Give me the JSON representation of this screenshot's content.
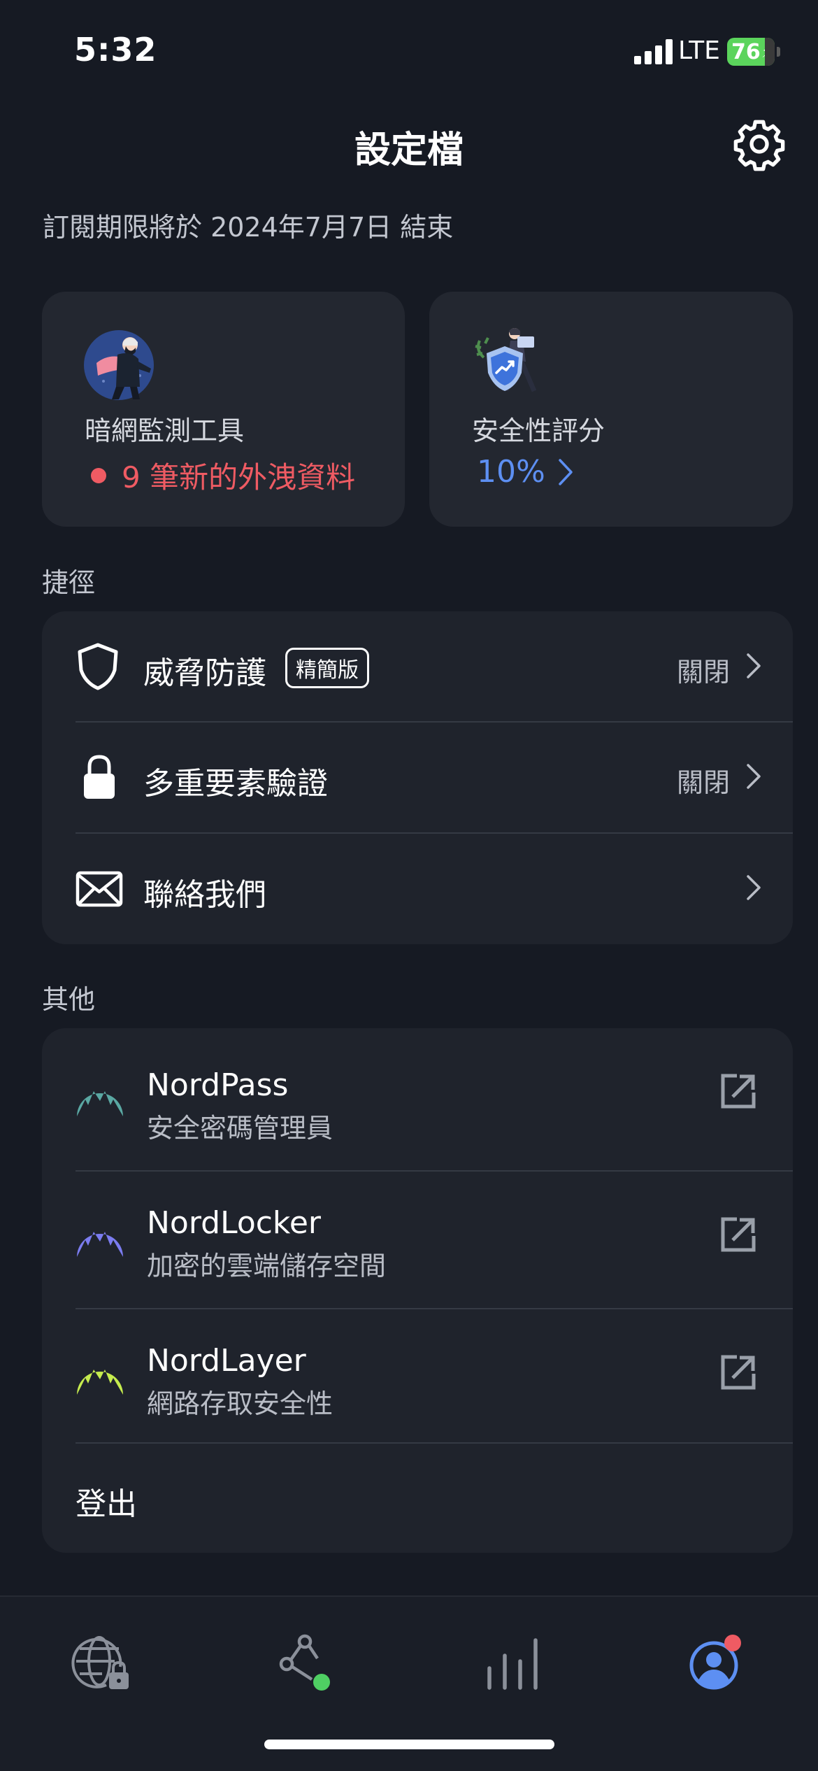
{
  "status_bar": {
    "time": "5:32",
    "network": "LTE",
    "battery": "76"
  },
  "header": {
    "title": "設定檔",
    "settings_icon": "gear-icon"
  },
  "subscription_text": "訂閱期限將於 2024年7月7日 結束",
  "cards": {
    "dark_web": {
      "label": "暗網監測工具",
      "alert": "9 筆新的外洩資料",
      "alert_color": "#ef5b63"
    },
    "security_score": {
      "label": "安全性評分",
      "value": "10%",
      "value_color": "#5d8ff2"
    }
  },
  "shortcuts": {
    "title": "捷徑",
    "items": [
      {
        "label": "威脅防護",
        "badge": "精簡版",
        "value": "關閉",
        "icon": "shield-icon"
      },
      {
        "label": "多重要素驗證",
        "value": "關閉",
        "icon": "lock-icon"
      },
      {
        "label": "聯絡我們",
        "icon": "mail-icon"
      }
    ]
  },
  "other": {
    "title": "其他",
    "apps": [
      {
        "name": "NordPass",
        "desc": "安全密碼管理員",
        "color": "#5aa8a3",
        "icon": "nordpass-logo-icon"
      },
      {
        "name": "NordLocker",
        "desc": "加密的雲端儲存空間",
        "color": "#7b7cf0",
        "icon": "nordlocker-logo-icon"
      },
      {
        "name": "NordLayer",
        "desc": "網路存取安全性",
        "color": "#c6ec4e",
        "icon": "nordlayer-logo-icon"
      }
    ],
    "logout": "登出"
  },
  "tab_bar": {
    "tabs": [
      "globe-lock-icon",
      "meshnet-icon",
      "stats-icon",
      "profile-icon"
    ],
    "active_color": "#5d8ff2"
  }
}
